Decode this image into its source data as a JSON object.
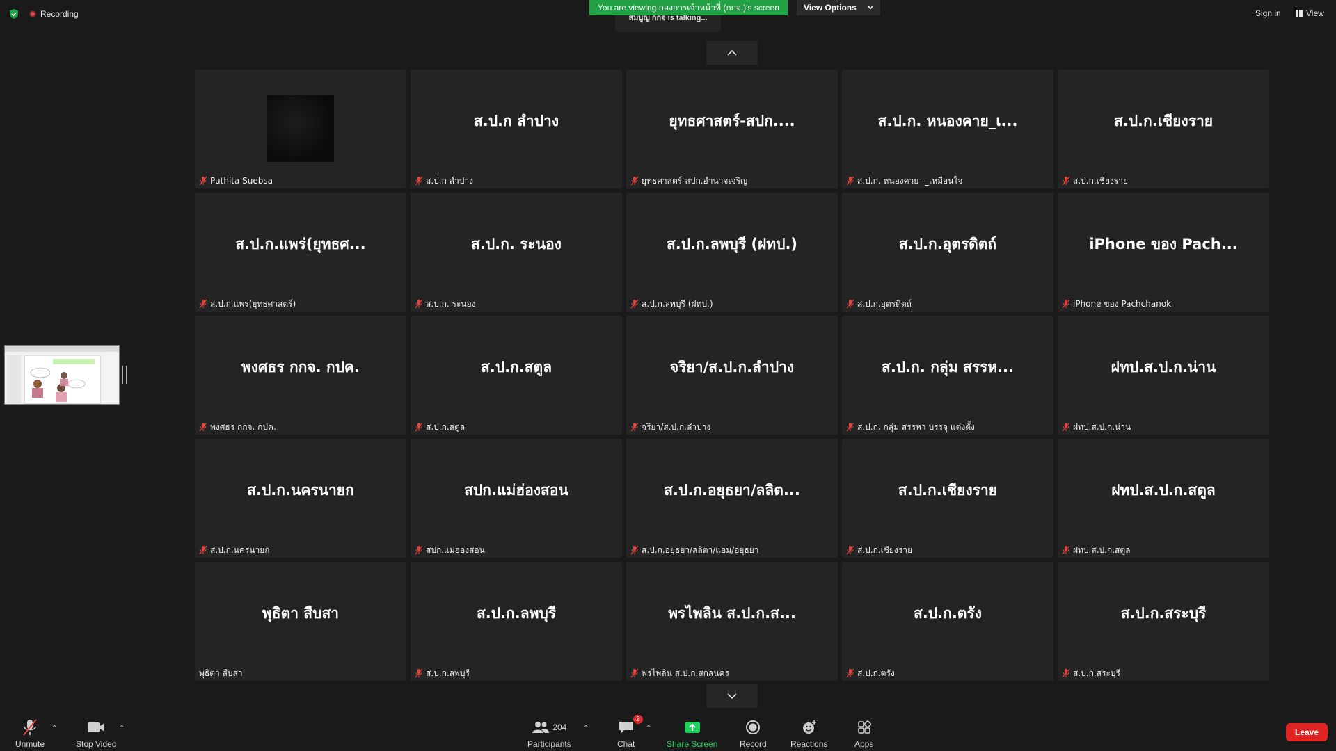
{
  "top": {
    "recording_label": "Recording",
    "talking_text": "สมบูญ กกจ is talking...",
    "viewing_banner": "You are viewing กองการเจ้าหน้าที่ (กกจ.)'s screen",
    "view_options_label": "View Options",
    "sign_in_label": "Sign in",
    "view_label": "View"
  },
  "tiles": [
    {
      "display": "",
      "name": "Puthita Suebsa",
      "muted": true,
      "video": true
    },
    {
      "display": "ส.ป.ก ลำปาง",
      "name": "ส.ป.ก ลำปาง",
      "muted": true
    },
    {
      "display": "ยุทธศาสตร์-สปก....",
      "name": "ยุทธศาสตร์-สปก.อำนาจเจริญ",
      "muted": true
    },
    {
      "display": "ส.ป.ก. หนองคาย_เ...",
      "name": "ส.ป.ก. หนองคาย--_เหมือนใจ",
      "muted": true
    },
    {
      "display": "ส.ป.ก.เชียงราย",
      "name": "ส.ป.ก.เชียงราย",
      "muted": true
    },
    {
      "display": "ส.ป.ก.แพร่(ยุทธศ...",
      "name": "ส.ป.ก.แพร่(ยุทธศาสตร์)",
      "muted": true
    },
    {
      "display": "ส.ป.ก. ระนอง",
      "name": "ส.ป.ก. ระนอง",
      "muted": true
    },
    {
      "display": "ส.ป.ก.ลพบุรี (ฝทป.)",
      "name": "ส.ป.ก.ลพบุรี (ฝทป.)",
      "muted": true
    },
    {
      "display": "ส.ป.ก.อุตรดิตถ์",
      "name": "ส.ป.ก.อุตรดิตถ์",
      "muted": true
    },
    {
      "display": "iPhone ของ Pach...",
      "name": "iPhone ของ Pachchanok",
      "muted": true
    },
    {
      "display": "พงศธร กกจ. กปค.",
      "name": "พงศธร กกจ. กปค.",
      "muted": true
    },
    {
      "display": "ส.ป.ก.สตูล",
      "name": "ส.ป.ก.สตูล",
      "muted": true
    },
    {
      "display": "จริยา/ส.ป.ก.ลำปาง",
      "name": "จริยา/ส.ป.ก.ลำปาง",
      "muted": true
    },
    {
      "display": "ส.ป.ก. กลุ่ม สรรห...",
      "name": "ส.ป.ก. กลุ่ม สรรหา บรรจุ แต่งตั้ง",
      "muted": true
    },
    {
      "display": "ฝทป.ส.ป.ก.น่าน",
      "name": "ฝทป.ส.ป.ก.น่าน",
      "muted": true
    },
    {
      "display": "ส.ป.ก.นครนายก",
      "name": "ส.ป.ก.นครนายก",
      "muted": true
    },
    {
      "display": "สปก.แม่ฮ่องสอน",
      "name": "สปก.แม่ฮ่องสอน",
      "muted": true
    },
    {
      "display": "ส.ป.ก.อยุธยา/ลลิต...",
      "name": "ส.ป.ก.อยุธยา/ลลิตา/แอม/อยุธยา",
      "muted": true
    },
    {
      "display": "ส.ป.ก.เชียงราย",
      "name": "ส.ป.ก.เชียงราย",
      "muted": true
    },
    {
      "display": "ฝทป.ส.ป.ก.สตูล",
      "name": "ฝทป.ส.ป.ก.สตูล",
      "muted": true
    },
    {
      "display": "พุธิตา สืบสา",
      "name": "พุธิตา สืบสา",
      "muted": false
    },
    {
      "display": "ส.ป.ก.ลพบุรี",
      "name": "ส.ป.ก.ลพบุรี",
      "muted": true
    },
    {
      "display": "พรไพลิน ส.ป.ก.ส...",
      "name": "พรไพลิน ส.ป.ก.สกลนคร",
      "muted": true
    },
    {
      "display": "ส.ป.ก.ตรัง",
      "name": "ส.ป.ก.ตรัง",
      "muted": true
    },
    {
      "display": "ส.ป.ก.สระบุรี",
      "name": "ส.ป.ก.สระบุรี",
      "muted": true
    }
  ],
  "toolbar": {
    "unmute_label": "Unmute",
    "stop_video_label": "Stop Video",
    "participants_label": "Participants",
    "participants_count": "204",
    "chat_label": "Chat",
    "chat_badge": "2",
    "share_screen_label": "Share Screen",
    "record_label": "Record",
    "reactions_label": "Reactions",
    "apps_label": "Apps",
    "leave_label": "Leave"
  },
  "colors": {
    "background": "#1a1a1a",
    "tile": "#242424",
    "banner_green": "#23a145",
    "share_green": "#23d160",
    "leave_red": "#e02424",
    "muted_red": "#e0443e"
  },
  "icons": {
    "security": "shield-check-icon",
    "recording": "recording-dot-icon",
    "muted": "mic-muted-icon",
    "view": "grid-view-icon"
  }
}
